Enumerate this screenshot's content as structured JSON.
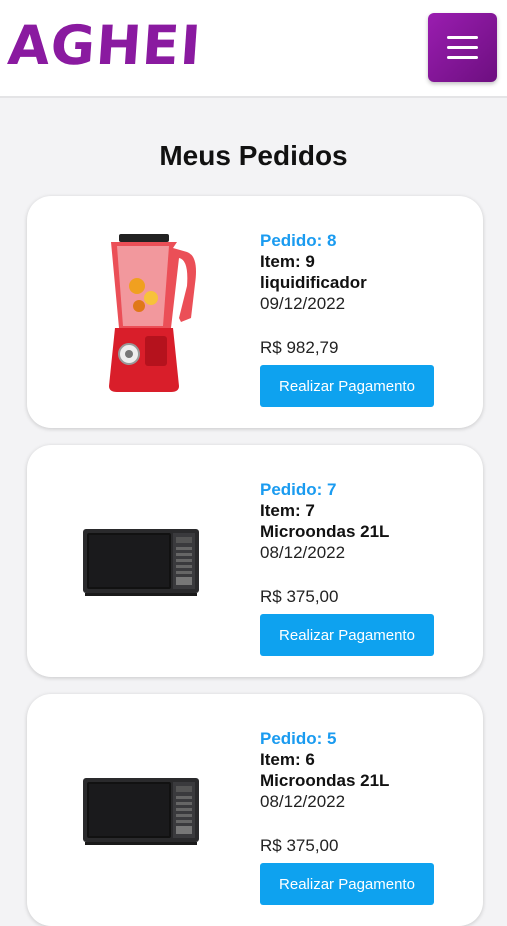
{
  "header": {
    "logo_text": "AGHEI",
    "menu_icon": "hamburger-menu-icon"
  },
  "page": {
    "title": "Meus Pedidos"
  },
  "orders": [
    {
      "order_label": "Pedido: 8",
      "item_label": "Item: 9",
      "product": "liquidificador",
      "date": "09/12/2022",
      "price": "R$ 982,79",
      "button": "Realizar Pagamento",
      "image": "blender"
    },
    {
      "order_label": "Pedido: 7",
      "item_label": "Item: 7",
      "product": "Microondas 21L",
      "date": "08/12/2022",
      "price": "R$ 375,00",
      "button": "Realizar Pagamento",
      "image": "microwave"
    },
    {
      "order_label": "Pedido: 5",
      "item_label": "Item: 6",
      "product": "Microondas 21L",
      "date": "08/12/2022",
      "price": "R$ 375,00",
      "button": "Realizar Pagamento",
      "image": "microwave"
    }
  ],
  "colors": {
    "brand": "#8a1aa0",
    "accent": "#1a9bf0",
    "button": "#0ea2ef"
  }
}
